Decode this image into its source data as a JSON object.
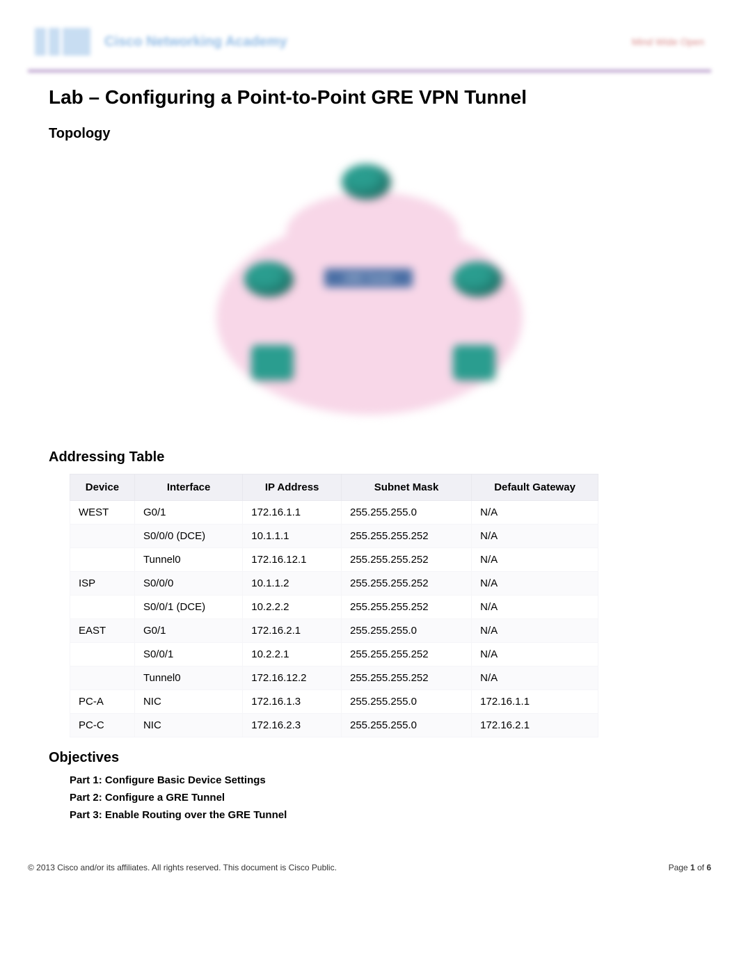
{
  "header": {
    "brand_text": "Cisco Networking Academy",
    "right_text": "Mind Wide Open"
  },
  "title": "Lab – Configuring a Point-to-Point GRE VPN Tunnel",
  "sections": {
    "topology": "Topology",
    "addressing": "Addressing Table",
    "objectives": "Objectives"
  },
  "topology": {
    "tunnel_label": "GRE Tunnel"
  },
  "table": {
    "headers": {
      "device": "Device",
      "interface": "Interface",
      "ip": "IP Address",
      "mask": "Subnet Mask",
      "gateway": "Default Gateway"
    },
    "rows": [
      {
        "device": "WEST",
        "interface": "G0/1",
        "ip": "172.16.1.1",
        "mask": "255.255.255.0",
        "gateway": "N/A"
      },
      {
        "device": "",
        "interface": "S0/0/0 (DCE)",
        "ip": "10.1.1.1",
        "mask": "255.255.255.252",
        "gateway": "N/A"
      },
      {
        "device": "",
        "interface": "Tunnel0",
        "ip": "172.16.12.1",
        "mask": "255.255.255.252",
        "gateway": "N/A"
      },
      {
        "device": "ISP",
        "interface": "S0/0/0",
        "ip": "10.1.1.2",
        "mask": "255.255.255.252",
        "gateway": "N/A"
      },
      {
        "device": "",
        "interface": "S0/0/1 (DCE)",
        "ip": "10.2.2.2",
        "mask": "255.255.255.252",
        "gateway": "N/A"
      },
      {
        "device": "EAST",
        "interface": "G0/1",
        "ip": "172.16.2.1",
        "mask": "255.255.255.0",
        "gateway": "N/A"
      },
      {
        "device": "",
        "interface": "S0/0/1",
        "ip": "10.2.2.1",
        "mask": "255.255.255.252",
        "gateway": "N/A"
      },
      {
        "device": "",
        "interface": "Tunnel0",
        "ip": "172.16.12.2",
        "mask": "255.255.255.252",
        "gateway": "N/A"
      },
      {
        "device": "PC-A",
        "interface": "NIC",
        "ip": "172.16.1.3",
        "mask": "255.255.255.0",
        "gateway": "172.16.1.1"
      },
      {
        "device": "PC-C",
        "interface": "NIC",
        "ip": "172.16.2.3",
        "mask": "255.255.255.0",
        "gateway": "172.16.2.1"
      }
    ]
  },
  "objectives": {
    "part1": "Part 1: Configure Basic Device Settings",
    "part2": "Part 2: Configure a GRE Tunnel",
    "part3": "Part 3: Enable Routing over the GRE Tunnel"
  },
  "footer": {
    "copyright": "© 2013 Cisco and/or its affiliates. All rights reserved. This document is Cisco Public.",
    "page_prefix": "Page ",
    "page_current": "1",
    "page_sep": " of ",
    "page_total": "6"
  }
}
